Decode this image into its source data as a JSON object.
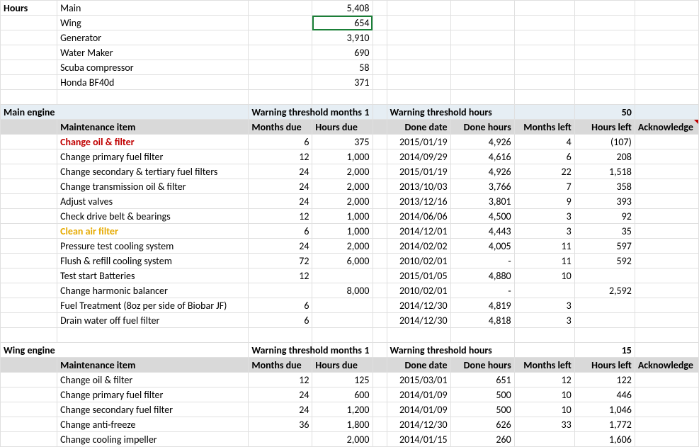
{
  "hours_label": "Hours",
  "hours_items": [
    {
      "name": "Main",
      "val": "5,408"
    },
    {
      "name": "Wing",
      "val": "654"
    },
    {
      "name": "Generator",
      "val": "3,910"
    },
    {
      "name": "Water Maker",
      "val": "690"
    },
    {
      "name": "Scuba compressor",
      "val": "58"
    },
    {
      "name": "Honda BF40d",
      "val": "371"
    }
  ],
  "sections": {
    "main": {
      "title": "Main engine",
      "wtm_label": "Warning threshold months",
      "wtm_val": "1",
      "wth_label": "Warning threshold hours",
      "wth_val": "50",
      "cols": {
        "item": "Maintenance item",
        "mdue": "Months due",
        "hdue": "Hours due",
        "ddate": "Done date",
        "dhours": "Done hours",
        "mleft": "Months left",
        "hleft": "Hours left",
        "ack": "Acknowledge"
      },
      "rows": [
        {
          "name": "Change oil & filter",
          "mdue": "6",
          "hdue": "375",
          "ddate": "2015/01/19",
          "dhours": "4,926",
          "mleft": "4",
          "hleft": "(107)",
          "style": "red"
        },
        {
          "name": "Change primary fuel filter",
          "mdue": "12",
          "hdue": "1,000",
          "ddate": "2014/09/29",
          "dhours": "4,616",
          "mleft": "6",
          "hleft": "208"
        },
        {
          "name": "Change secondary & tertiary fuel filters",
          "mdue": "24",
          "hdue": "2,000",
          "ddate": "2015/01/19",
          "dhours": "4,926",
          "mleft": "22",
          "hleft": "1,518"
        },
        {
          "name": "Change transmission oil & filter",
          "mdue": "24",
          "hdue": "2,000",
          "ddate": "2013/10/03",
          "dhours": "3,766",
          "mleft": "7",
          "hleft": "358"
        },
        {
          "name": "Adjust valves",
          "mdue": "24",
          "hdue": "2,000",
          "ddate": "2013/12/16",
          "dhours": "3,801",
          "mleft": "9",
          "hleft": "393"
        },
        {
          "name": "Check drive belt & bearings",
          "mdue": "12",
          "hdue": "1,000",
          "ddate": "2014/06/06",
          "dhours": "4,500",
          "mleft": "3",
          "hleft": "92"
        },
        {
          "name": "Clean air filter",
          "mdue": "6",
          "hdue": "1,000",
          "ddate": "2014/12/01",
          "dhours": "4,443",
          "mleft": "3",
          "hleft": "35",
          "style": "orange"
        },
        {
          "name": "Pressure test cooling system",
          "mdue": "24",
          "hdue": "2,000",
          "ddate": "2014/02/02",
          "dhours": "4,005",
          "mleft": "11",
          "hleft": "597"
        },
        {
          "name": "Flush & refill cooling system",
          "mdue": "72",
          "hdue": "6,000",
          "ddate": "2010/02/01",
          "dhours": "-",
          "mleft": "11",
          "hleft": "592"
        },
        {
          "name": "Test start Batteries",
          "mdue": "12",
          "hdue": "",
          "ddate": "2015/01/05",
          "dhours": "4,880",
          "mleft": "10",
          "hleft": ""
        },
        {
          "name": "Change harmonic balancer",
          "mdue": "",
          "hdue": "8,000",
          "ddate": "2010/02/01",
          "dhours": "-",
          "mleft": "",
          "hleft": "2,592"
        },
        {
          "name": "Fuel Treatment (8oz per side of Biobar JF)",
          "mdue": "6",
          "hdue": "",
          "ddate": "2014/12/30",
          "dhours": "4,819",
          "mleft": "3",
          "hleft": ""
        },
        {
          "name": "Drain water off fuel filter",
          "mdue": "6",
          "hdue": "",
          "ddate": "2014/12/30",
          "dhours": "4,818",
          "mleft": "3",
          "hleft": ""
        }
      ]
    },
    "wing": {
      "title": "Wing engine",
      "wtm_label": "Warning threshold months",
      "wtm_val": "1",
      "wth_label": "Warning threshold hours",
      "wth_val": "15",
      "cols": {
        "item": "Maintenance item",
        "mdue": "Months due",
        "hdue": "Hours due",
        "ddate": "Done date",
        "dhours": "Done hours",
        "mleft": "Months left",
        "hleft": "Hours left",
        "ack": "Acknowledge"
      },
      "rows": [
        {
          "name": "Change oil & filter",
          "mdue": "12",
          "hdue": "125",
          "ddate": "2015/03/01",
          "dhours": "651",
          "mleft": "12",
          "hleft": "122"
        },
        {
          "name": "Change primary fuel filter",
          "mdue": "24",
          "hdue": "600",
          "ddate": "2014/01/09",
          "dhours": "500",
          "mleft": "10",
          "hleft": "446"
        },
        {
          "name": "Change secondary fuel filter",
          "mdue": "24",
          "hdue": "1,200",
          "ddate": "2014/01/09",
          "dhours": "500",
          "mleft": "10",
          "hleft": "1,046"
        },
        {
          "name": "Change anti-freeze",
          "mdue": "36",
          "hdue": "1,800",
          "ddate": "2014/12/30",
          "dhours": "626",
          "mleft": "33",
          "hleft": "1,772"
        },
        {
          "name": "Change cooling impeller",
          "mdue": "",
          "hdue": "2,000",
          "ddate": "2014/01/15",
          "dhours": "260",
          "mleft": "",
          "hleft": "1,606"
        }
      ]
    }
  }
}
